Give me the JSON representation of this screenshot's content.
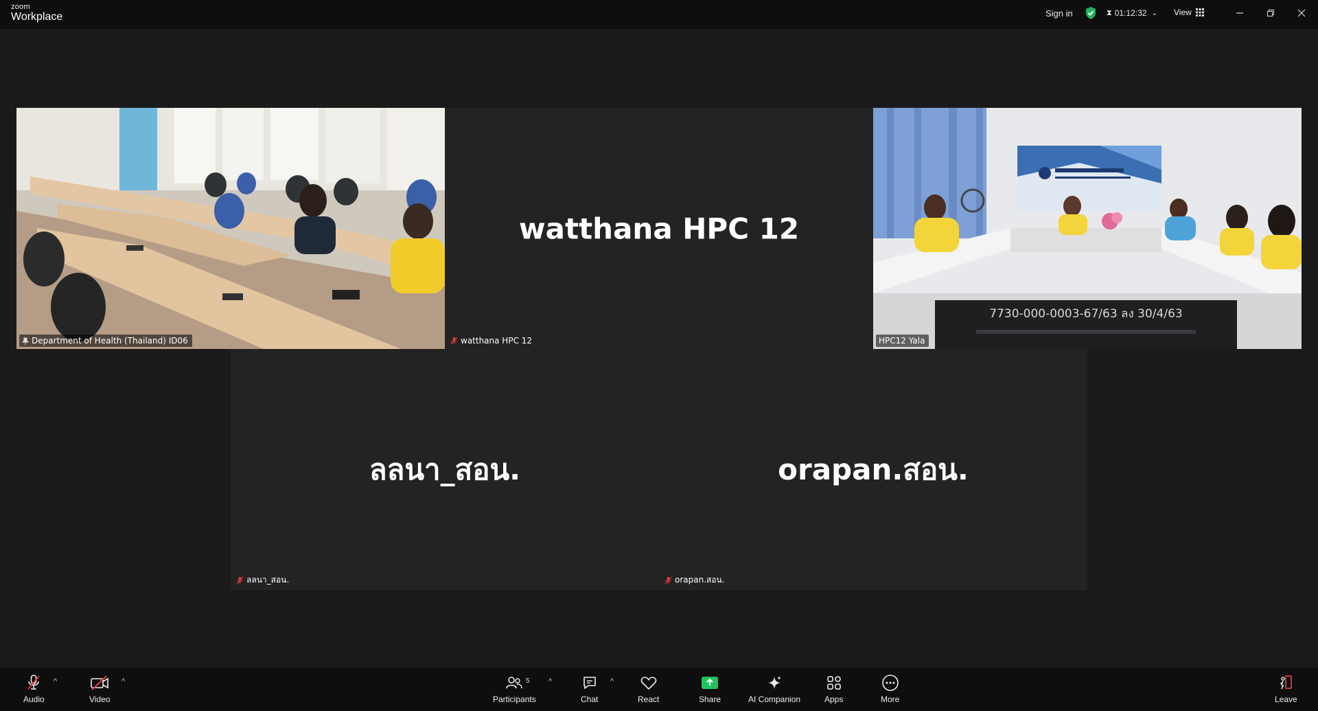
{
  "app": {
    "logo_top": "zoom",
    "logo_bottom": "Workplace"
  },
  "titlebar": {
    "sign_in": "Sign in",
    "timer": "01:12:32",
    "view": "View"
  },
  "tiles": {
    "t1": {
      "name": "Department of Health (Thailand) ID06"
    },
    "t2": {
      "display": "watthana HPC 12",
      "name": "watthana HPC 12"
    },
    "t3": {
      "name": "HPC12 Yala",
      "screen_text": "7730-000-0003-67/63 ลง 30/4/63"
    },
    "t4": {
      "display": "ลลนา_สอน.",
      "name": "ลลนา_สอน."
    },
    "t5": {
      "display": "orapan.สอน.",
      "name": "orapan.สอน."
    }
  },
  "toolbar": {
    "audio": "Audio",
    "video": "Video",
    "participants": "Participants",
    "participants_count": "5",
    "chat": "Chat",
    "react": "React",
    "share": "Share",
    "ai_companion": "AI Companion",
    "apps": "Apps",
    "more": "More",
    "leave": "Leave"
  },
  "colors": {
    "active_speaker": "#27c46b",
    "share_green": "#22c35e",
    "muted_red": "#e03c3c",
    "tile_bg": "#232323"
  }
}
